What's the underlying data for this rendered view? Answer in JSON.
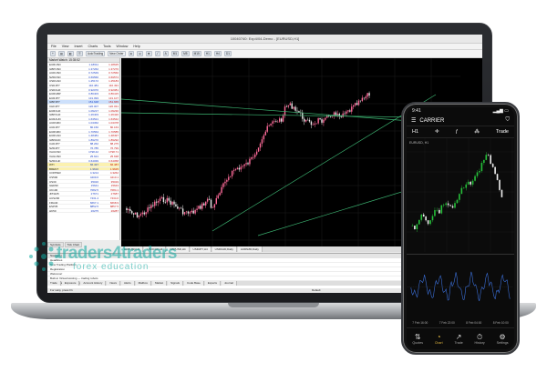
{
  "window": {
    "title": "10040740: Exp4/04-Demo - [EURUSD,H1]"
  },
  "menu": [
    "File",
    "View",
    "Insert",
    "Charts",
    "Tools",
    "Window",
    "Help"
  ],
  "toolbar": {
    "new_order": "New Order",
    "auto_trading": "AutoTrading"
  },
  "market_watch": {
    "title": "Market Watch: 15:35:52",
    "columns": [
      "Symbol",
      "Bid",
      "Ask"
    ],
    "rows": [
      {
        "sym": "EURUSD",
        "bid": "1.18611",
        "ask": "1.18625"
      },
      {
        "sym": "GBPUSD",
        "bid": "1.37262",
        "ask": "1.37270"
      },
      {
        "sym": "AUDUSD",
        "bid": "0.72549",
        "ask": "0.72560"
      },
      {
        "sym": "NZDUSD",
        "bid": "0.69560",
        "ask": "0.69574"
      },
      {
        "sym": "USDCAD",
        "bid": "1.25172",
        "ask": "1.25183"
      },
      {
        "sym": "USDJPY",
        "bid": "110.481",
        "ask": "110.491"
      },
      {
        "sym": "USDCHF",
        "bid": "0.92070",
        "ask": "0.92081"
      },
      {
        "sym": "EURGBP",
        "bid": "0.86403",
        "ask": "0.86415"
      },
      {
        "sym": "EURJPY",
        "bid": "131.093",
        "ask": "131.107"
      },
      {
        "sym": "GBPJPY",
        "bid": "151.648",
        "ask": "151.665"
      },
      {
        "sym": "CHFJPY",
        "bid": "120.007",
        "ask": "120.031"
      },
      {
        "sym": "EURCHF",
        "bid": "1.09217",
        "ask": "1.09230"
      },
      {
        "sym": "GBPCHF",
        "bid": "1.26403",
        "ask": "1.26420"
      },
      {
        "sym": "EURAUD",
        "bid": "1.63521",
        "ask": "1.63542"
      },
      {
        "sym": "AUDNZD",
        "bid": "1.04362",
        "ask": "1.04378"
      },
      {
        "sym": "AUDJPY",
        "bid": "80.150",
        "ask": "80.163"
      },
      {
        "sym": "EURNZD",
        "bid": "1.70564",
        "ask": "1.70585"
      },
      {
        "sym": "EURCAD",
        "bid": "1.48481",
        "ask": "1.48497"
      },
      {
        "sym": "GBPAUD",
        "bid": "1.89270",
        "ask": "1.89292"
      },
      {
        "sym": "CADJPY",
        "bid": "88.262",
        "ask": "88.275"
      },
      {
        "sym": "NZDJPY",
        "bid": "76.785",
        "ask": "76.799"
      },
      {
        "sym": "XAUUSD",
        "bid": "1798.42",
        "ask": "1798.71"
      },
      {
        "sym": "XAGUSD",
        "bid": "25.621",
        "ask": "25.638"
      },
      {
        "sym": "NZDCHF",
        "bid": "0.64039",
        "ask": "0.64058"
      },
      {
        "sym": "WTI",
        "bid": "66.437",
        "ask": "66.487"
      },
      {
        "sym": "BRENT",
        "bid": "1.9610",
        "ask": "1.9625"
      },
      {
        "sym": "COPPER",
        "bid": "4.3214",
        "ask": "4.3262"
      },
      {
        "sym": "US500",
        "bid": "4409.6",
        "ask": "4410.1"
      },
      {
        "sym": "US30",
        "bid": "35016",
        "ask": "35019"
      },
      {
        "sym": "GER30",
        "bid": "15641",
        "ask": "15643"
      },
      {
        "sym": "UK100",
        "bid": "7082.5",
        "ask": "7084.1"
      },
      {
        "sym": "JPN225",
        "bid": "27671",
        "ask": "27687"
      },
      {
        "sym": "AUS200",
        "bid": "7431.4",
        "ask": "7434.0"
      },
      {
        "sym": "FRA40",
        "bid": "6667.1",
        "ask": "6668.9"
      },
      {
        "sym": "ESP35",
        "bid": "8852.5",
        "ask": "8857.5"
      },
      {
        "sym": "HK50",
        "bid": "26275",
        "ask": "26287"
      }
    ],
    "tabs": [
      "Symbols",
      "Tick Chart"
    ]
  },
  "chart_tabs": [
    "EURUSD,H1",
    "USDCHF,H4",
    "GBPUSD,H4",
    "USDJPY,H4",
    "USDCAD,Daily",
    "AUDNZD,Daily"
  ],
  "terminal": {
    "title": "Navigator",
    "rows": [
      {
        "a": "Headlines",
        "b": "",
        "c": "From"
      },
      {
        "a": "New Trading Platform",
        "b": "",
        "c": "Trading Platform"
      },
      {
        "a": "Registration",
        "b": "",
        "c": "Trading Platform"
      },
      {
        "a": "Welcome!",
        "b": "",
        "c": "Trading Platform"
      },
      {
        "a": "Built-in Virtual Hosting — trading robots and signals now working 24/7",
        "b": "",
        "c": "Trading Platform"
      }
    ],
    "tabs": [
      "Trade",
      "Exposure",
      "Account History",
      "News",
      "Alerts",
      "Mailbox",
      "Market",
      "Signals",
      "Code Base",
      "Experts",
      "Journal"
    ]
  },
  "status": {
    "help": "For Help, press F1",
    "profile": "Default"
  },
  "watermark": {
    "brand": "traders4traders",
    "tagline": "forex education"
  },
  "phone": {
    "time": "9:41",
    "account": "CARRIER",
    "timeframe": "H1",
    "trade_label": "Trade",
    "symbol": "EURUSD, H1",
    "nav": [
      "Quotes",
      "Chart",
      "Trade",
      "History",
      "Settings"
    ],
    "dates": [
      "7 Feb 16:00",
      "7 Feb 22:00",
      "8 Feb 04:00",
      "8 Feb 10:00"
    ]
  },
  "colors": {
    "bull_laptop": "#ff6b9a",
    "bear_laptop": "#eaeaea",
    "trendline": "#3cb371",
    "bull_phone": "#26c13a",
    "bear_phone": "#f0f0f0",
    "accent_phone": "#e0b640"
  }
}
